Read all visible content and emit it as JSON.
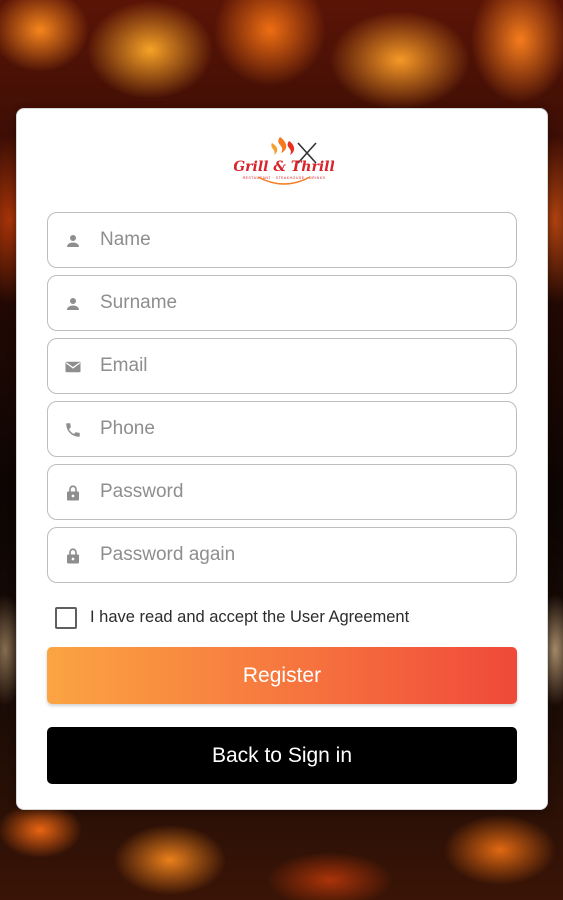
{
  "logo": {
    "text": "Grill & Thrill",
    "brand_color": "#d9232a",
    "flame_color": "#f47a20"
  },
  "form": {
    "fields": [
      {
        "name": "name",
        "icon": "person-icon",
        "placeholder": "Name",
        "value": ""
      },
      {
        "name": "surname",
        "icon": "person-icon",
        "placeholder": "Surname",
        "value": ""
      },
      {
        "name": "email",
        "icon": "mail-icon",
        "placeholder": "Email",
        "value": ""
      },
      {
        "name": "phone",
        "icon": "phone-icon",
        "placeholder": "Phone",
        "value": ""
      },
      {
        "name": "password",
        "icon": "lock-icon",
        "placeholder": "Password",
        "value": ""
      },
      {
        "name": "password_again",
        "icon": "lock-icon",
        "placeholder": "Password again",
        "value": ""
      }
    ],
    "agreement_label": "I have read and accept the User Agreement",
    "agreement_checked": false,
    "register_label": "Register",
    "back_label": "Back to Sign in"
  },
  "colors": {
    "register_gradient_start": "#fba443",
    "register_gradient_end": "#f0493a",
    "back_button": "#000000",
    "icon_gray": "#8e8e8e"
  }
}
